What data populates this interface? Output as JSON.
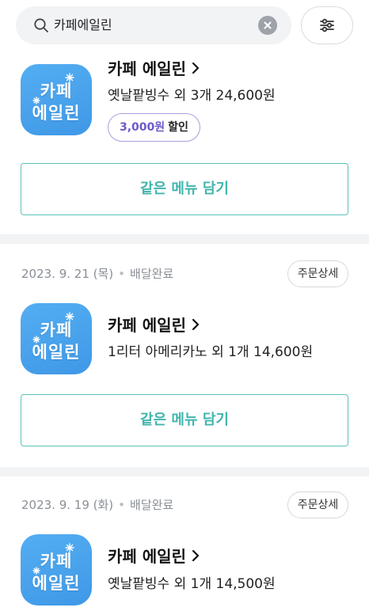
{
  "search": {
    "query": "카페에일린"
  },
  "orders": [
    {
      "logo": {
        "line1": "카페",
        "line2": "에일린"
      },
      "store": "카페 에일린",
      "summary": "옛날팥빙수 외 3개 24,600원",
      "discount": {
        "amount": "3,000원",
        "label": "할인"
      },
      "reorder_label": "같은 메뉴 담기"
    },
    {
      "date": "2023. 9. 21 (목)",
      "status": "배달완료",
      "detail_label": "주문상세",
      "logo": {
        "line1": "카페",
        "line2": "에일린"
      },
      "store": "카페 에일린",
      "summary": "1리터 아메리카노 외 1개 14,600원",
      "reorder_label": "같은 메뉴 담기"
    },
    {
      "date": "2023. 9. 19 (화)",
      "status": "배달완료",
      "detail_label": "주문상세",
      "logo": {
        "line1": "카페",
        "line2": "에일린"
      },
      "store": "카페 에일린",
      "summary": "옛날팥빙수 외 1개 14,500원"
    }
  ],
  "colors": {
    "accent_teal": "#42b5ad",
    "discount_purple": "#6b5bc9",
    "logo_blue": "#4aa3ec"
  }
}
